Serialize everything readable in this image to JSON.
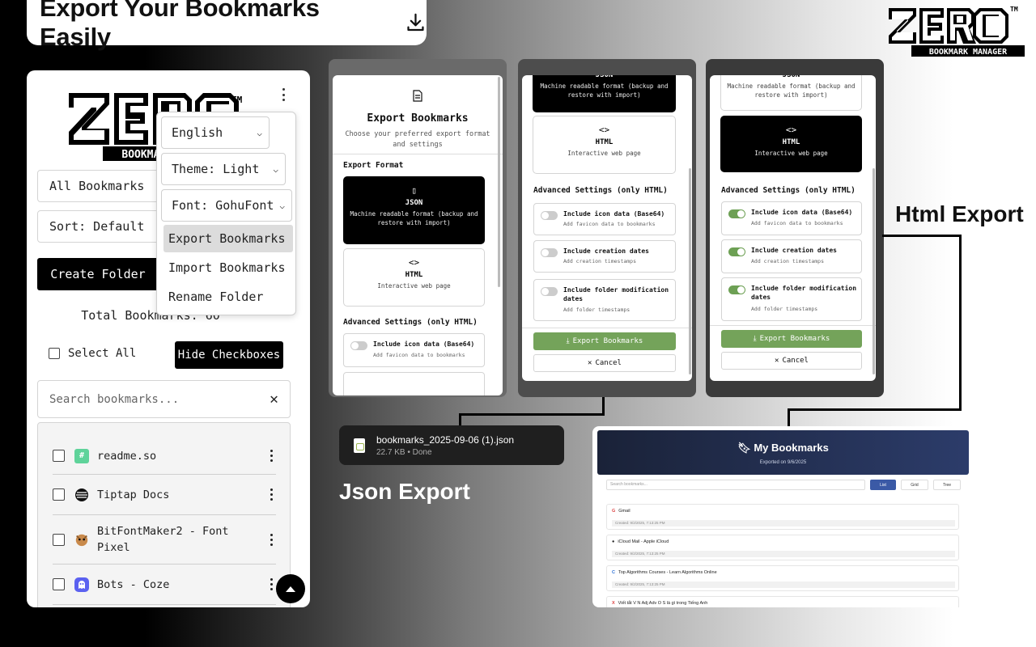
{
  "headline": {
    "text": "Export Your Bookmarks Easily"
  },
  "extension": {
    "filter_value": "All Bookmarks",
    "sort_value": "Sort: Default",
    "create_folder_label": "Create Folder",
    "total_label": "Total Bookmarks: 60",
    "select_all_label": "Select All",
    "hide_checkboxes_label": "Hide Checkboxes",
    "search_placeholder": "Search bookmarks...",
    "bookmarks": [
      {
        "title": "readme.so"
      },
      {
        "title": "Tiptap Docs"
      },
      {
        "title": "BitFontMaker2 - Font Pixel"
      },
      {
        "title": "Bots - Coze"
      }
    ]
  },
  "menu": {
    "language": "English",
    "theme": "Theme: Light",
    "font": "Font: GohuFont",
    "items": [
      "Export Bookmarks",
      "Import Bookmarks",
      "Rename Folder"
    ]
  },
  "dialog": {
    "title": "Export Bookmarks",
    "subtitle": "Choose your preferred export format and settings",
    "format_label": "Export Format",
    "json_name": "JSON",
    "json_desc": "Machine readable format (backup and restore with import)",
    "html_name": "HTML",
    "html_desc": "Interactive web page",
    "advanced_label": "Advanced Settings (only HTML)",
    "options": [
      {
        "title": "Include icon data (Base64)",
        "desc": "Add favicon data to bookmarks"
      },
      {
        "title": "Include creation dates",
        "desc": "Add creation timestamps"
      },
      {
        "title": "Include folder modification dates",
        "desc": "Add folder timestamps"
      }
    ],
    "export_btn": "Export Bookmarks",
    "cancel_btn": "Cancel"
  },
  "download": {
    "filename": "bookmarks_2025-09-06 (1).json",
    "meta": "22.7 KB • Done"
  },
  "captions": {
    "json": "Json Export",
    "html": "Html Export"
  },
  "html_page": {
    "title": "My Bookmarks",
    "exported": "Exported on 9/6/2025",
    "search_placeholder": "Search bookmarks...",
    "view_buttons": [
      "List",
      "Grid",
      "Tree"
    ],
    "rows": [
      {
        "name": "Gmail",
        "date": "Created: 9/2/2025, 7:13:25 PM"
      },
      {
        "name": "iCloud Mail - Apple iCloud",
        "date": "Created: 9/2/2025, 7:13:25 PM"
      },
      {
        "name": "Top Algorithms Courses - Learn Algorithms Online",
        "date": "Created: 9/2/2025, 7:13:25 PM"
      },
      {
        "name": "Viết tắt V N Adj Adv O S là gì trong Tiếng Anh",
        "date": ""
      }
    ]
  },
  "colors": {
    "accent_green": "#74a35a",
    "html_header": "#2c3c6a",
    "html_button": "#3b5aa6"
  }
}
